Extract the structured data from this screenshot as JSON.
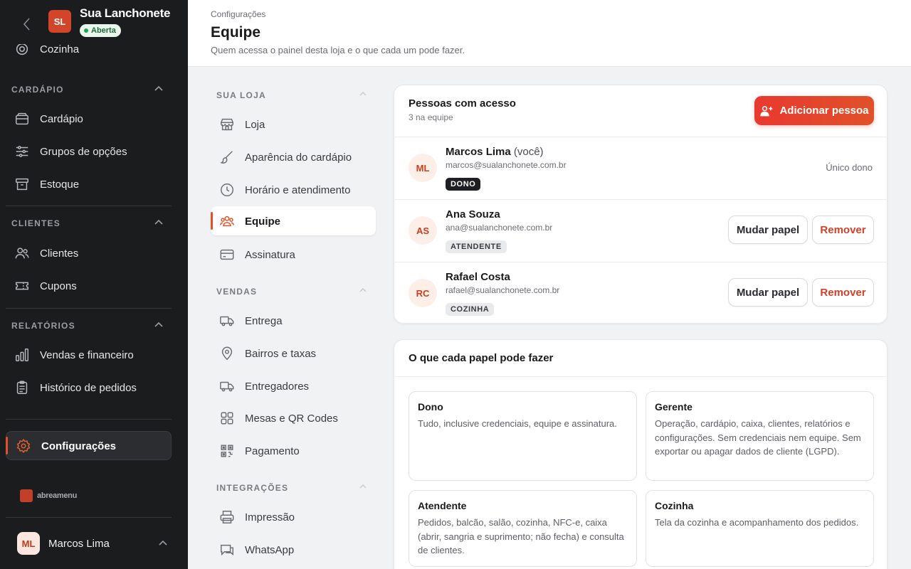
{
  "store": {
    "initials": "SL",
    "name": "Sua Lanchonete",
    "status": "Aberta"
  },
  "sidebar": {
    "cut_item": "Cozinha",
    "sections": [
      {
        "title": "CARDÁPIO",
        "items": [
          "Cardápio",
          "Grupos de opções",
          "Estoque"
        ]
      },
      {
        "title": "CLIENTES",
        "items": [
          "Clientes",
          "Cupons"
        ]
      },
      {
        "title": "RELATÓRIOS",
        "items": [
          "Vendas e financeiro",
          "Histórico de pedidos"
        ]
      }
    ],
    "active_item": "Configurações",
    "brand": "abreamenu"
  },
  "user": {
    "initials": "ML",
    "name": "Marcos Lima"
  },
  "header": {
    "breadcrumb": "Configurações",
    "title": "Equipe",
    "subtitle": "Quem acessa o painel desta loja e o que cada um pode fazer."
  },
  "settings_nav": {
    "sections": [
      {
        "title": "SUA LOJA",
        "items": [
          "Loja",
          "Aparência do cardápio",
          "Horário e atendimento",
          "Equipe",
          "Assinatura"
        ]
      },
      {
        "title": "VENDAS",
        "items": [
          "Entrega",
          "Bairros e taxas",
          "Entregadores",
          "Mesas e QR Codes",
          "Pagamento"
        ]
      },
      {
        "title": "INTEGRAÇÕES",
        "items": [
          "Impressão",
          "WhatsApp"
        ]
      }
    ]
  },
  "access": {
    "title": "Pessoas com acesso",
    "count": "3 na equipe",
    "add_label": "Adicionar pessoa",
    "change_label": "Mudar papel",
    "remove_label": "Remover",
    "people": [
      {
        "initials": "ML",
        "name": "Marcos Lima",
        "you": "(você)",
        "email": "marcos@sualanchonete.com.br",
        "role": "DONO",
        "note": "Único dono"
      },
      {
        "initials": "AS",
        "name": "Ana Souza",
        "email": "ana@sualanchonete.com.br",
        "role": "ATENDENTE"
      },
      {
        "initials": "RC",
        "name": "Rafael Costa",
        "email": "rafael@sualanchonete.com.br",
        "role": "COZINHA"
      }
    ]
  },
  "roles": {
    "title": "O que cada papel pode fazer",
    "items": [
      {
        "name": "Dono",
        "desc": "Tudo, inclusive credenciais, equipe e assinatura."
      },
      {
        "name": "Gerente",
        "desc": "Operação, cardápio, caixa, clientes, relatórios e configurações. Sem credenciais nem equipe. Sem exportar ou apagar dados de cliente (LGPD)."
      },
      {
        "name": "Atendente",
        "desc": "Pedidos, balcão, salão, cozinha, NFC-e, caixa (abrir, sangria e suprimento; não fecha) e consulta de clientes."
      },
      {
        "name": "Cozinha",
        "desc": "Tela da cozinha e acompanhamento dos pedidos."
      }
    ]
  },
  "colors": {
    "accent": "#e0502a",
    "sidebar_bg": "#1b1c1e",
    "success": "#22a553"
  }
}
